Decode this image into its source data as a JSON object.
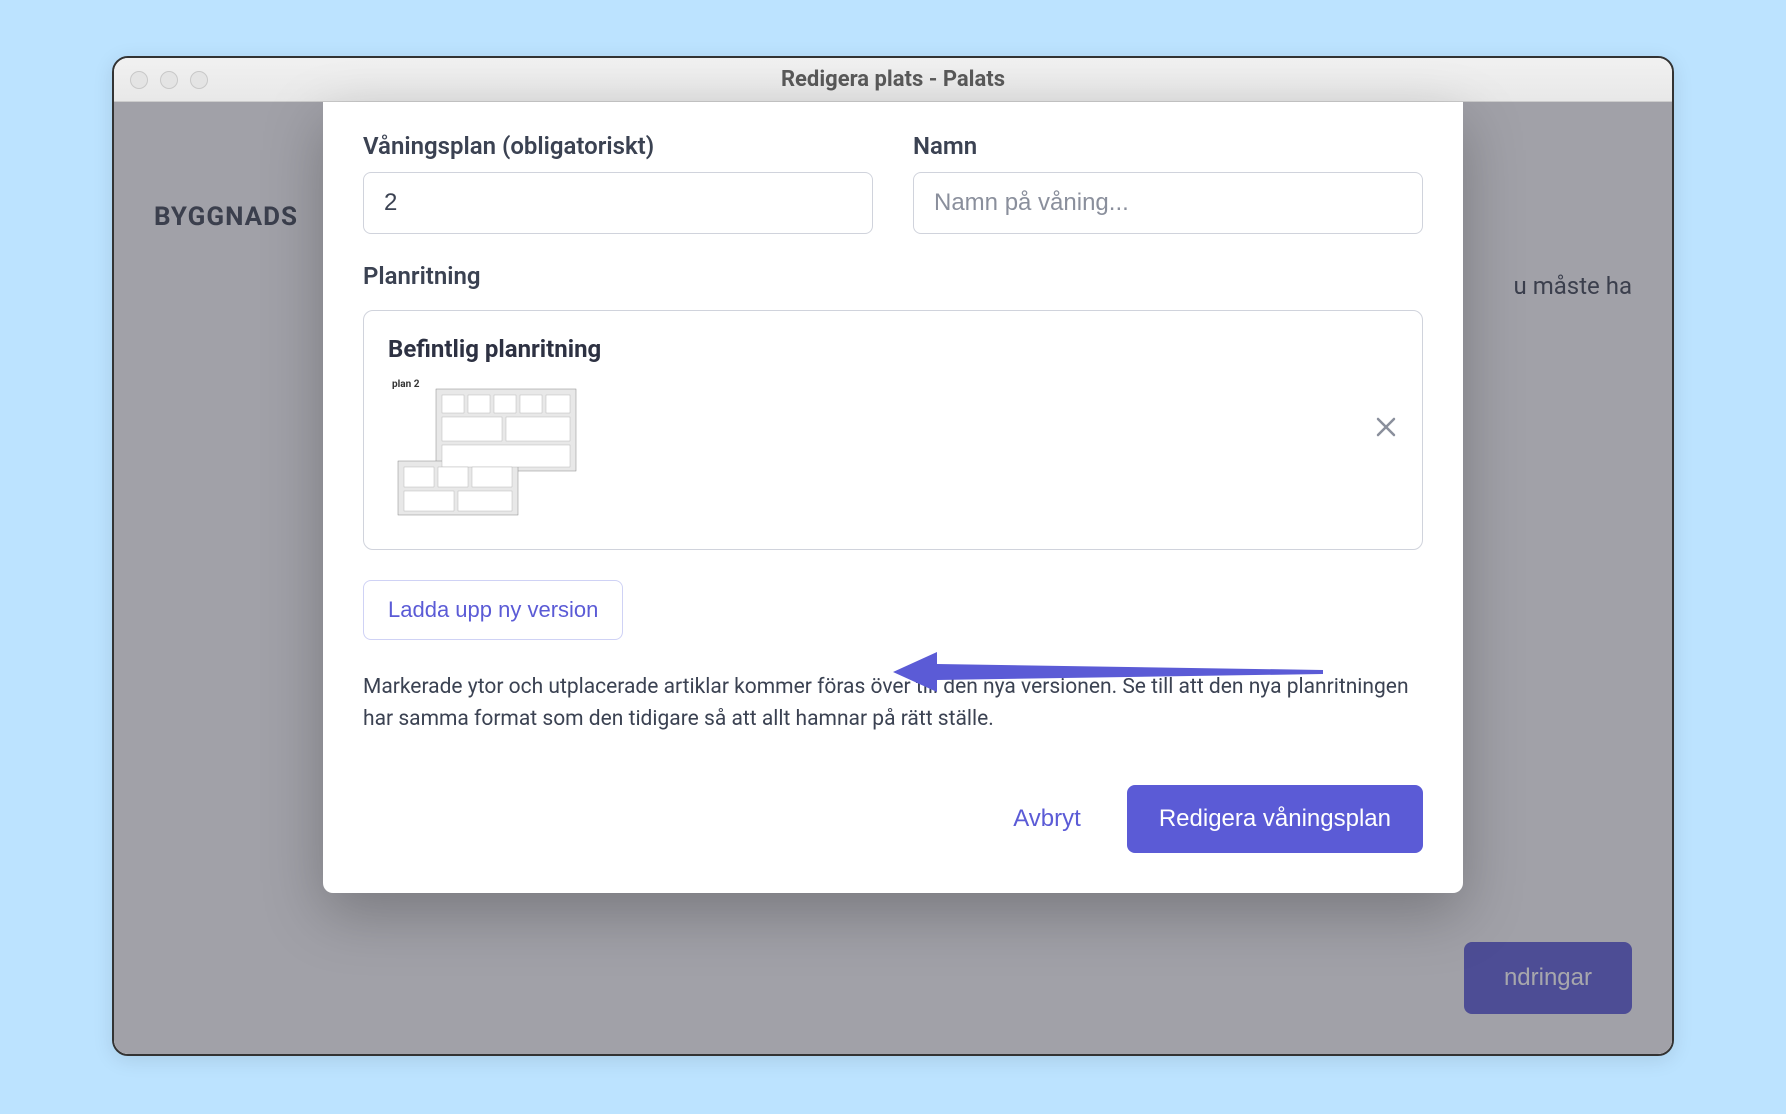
{
  "window": {
    "title": "Redigera plats - Palats"
  },
  "background": {
    "heading": "BYGGNADS",
    "right_snippet": "u måste ha",
    "footer_button": "ndringar"
  },
  "modal": {
    "fields": {
      "floor": {
        "label": "Våningsplan (obligatoriskt)",
        "value": "2"
      },
      "name": {
        "label": "Namn",
        "placeholder": "Namn på våning..."
      }
    },
    "plan_section_label": "Planritning",
    "existing_plan": {
      "title": "Befintlig planritning",
      "thumb_label": "plan 2"
    },
    "upload_button": "Ladda upp ny version",
    "help_text": "Markerade ytor och utplacerade artiklar kommer föras över till den nya versionen. Se till att den nya planritningen har samma format som den tidigare så att allt hamnar på rätt ställe.",
    "footer": {
      "cancel": "Avbryt",
      "submit": "Redigera våningsplan"
    }
  },
  "colors": {
    "accent": "#5b5bd6",
    "page_bg": "#bce3ff"
  }
}
